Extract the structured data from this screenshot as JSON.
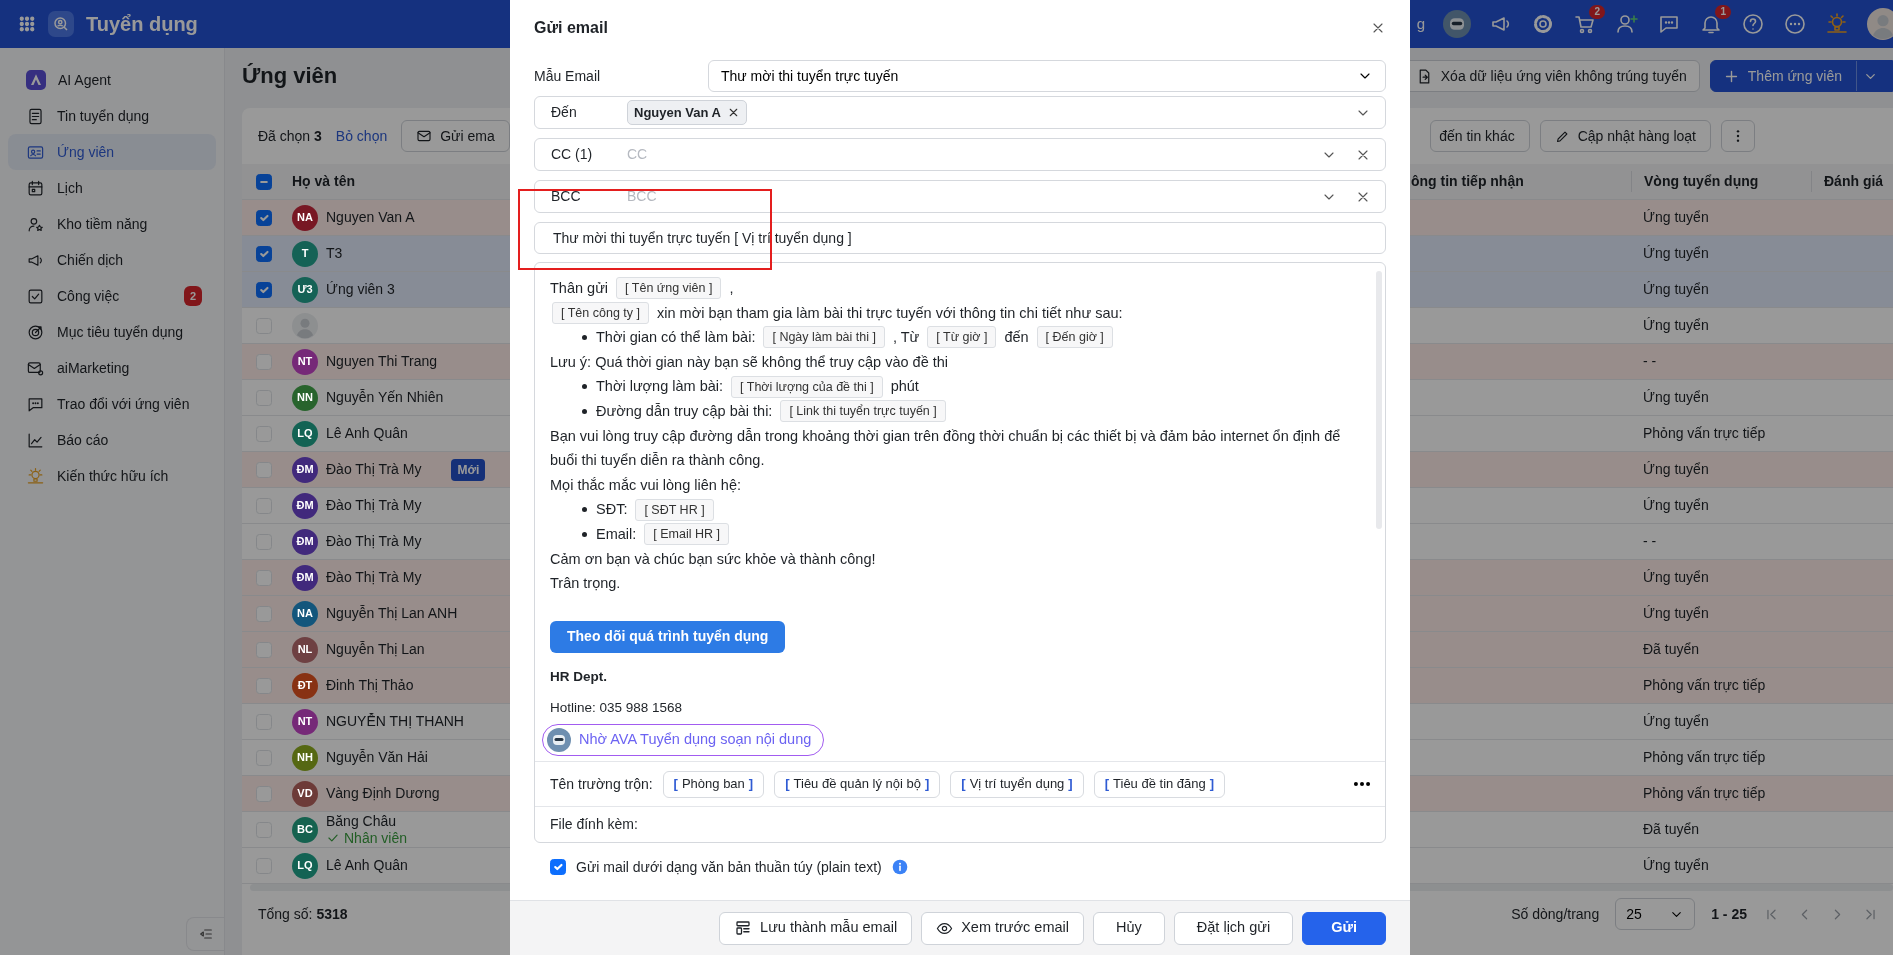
{
  "topbar": {
    "app_title": "Tuyển dụng",
    "clipped_text": "g",
    "actions": [
      {
        "kind": "robot"
      },
      {
        "kind": "megaphone"
      },
      {
        "kind": "gear"
      },
      {
        "kind": "cart",
        "badge": "2"
      },
      {
        "kind": "user-plus"
      },
      {
        "kind": "chat"
      },
      {
        "kind": "bell",
        "badge": "1"
      },
      {
        "kind": "help"
      },
      {
        "kind": "more"
      },
      {
        "kind": "bulb"
      },
      {
        "kind": "avatar"
      }
    ]
  },
  "sidebar": {
    "items": [
      {
        "label": "AI Agent",
        "kind": "agent",
        "selected": false
      },
      {
        "label": "Tin tuyển dụng",
        "kind": "news",
        "selected": false
      },
      {
        "label": "Ứng viên",
        "kind": "idcard",
        "selected": true
      },
      {
        "label": "Lịch",
        "kind": "calendar",
        "selected": false
      },
      {
        "label": "Kho tiềm năng",
        "kind": "talent",
        "selected": false
      },
      {
        "label": "Chiến dịch",
        "kind": "megaphone",
        "selected": false
      },
      {
        "label": "Công việc",
        "kind": "task",
        "selected": false,
        "badge": "2"
      },
      {
        "label": "Mục tiêu tuyển dụng",
        "kind": "target",
        "selected": false
      },
      {
        "label": "aiMarketing",
        "kind": "mailgear",
        "selected": false
      },
      {
        "label": "Trao đổi với ứng viên",
        "kind": "chat",
        "selected": false
      },
      {
        "label": "Báo cáo",
        "kind": "chart",
        "selected": false
      },
      {
        "label": "Kiến thức hữu ích",
        "kind": "bulb",
        "selected": false
      }
    ]
  },
  "page": {
    "title": "Ứng viên",
    "actions": [
      {
        "label": "Xóa dữ liệu ứng viên không trúng tuyển",
        "kind": "outline"
      },
      {
        "label": "Thêm ứng viên",
        "kind": "primary"
      }
    ]
  },
  "table": {
    "selected_label": "Đã chọn",
    "selected_count": "3",
    "clear_selection": "Bỏ chọn",
    "left_actions": [
      {
        "label": "Gửi ema",
        "kind": "mail"
      }
    ],
    "right_actions": [
      {
        "label": "đến tin khác",
        "kind": "plain"
      },
      {
        "label": "Cập nhật hàng loạt",
        "kind": "edit"
      },
      {
        "kind": "kebab"
      }
    ],
    "header_checkbox": {
      "indeterminate": true
    },
    "columns": [
      "Họ và tên",
      "ông tin tiếp nhận",
      "Vòng tuyển dụng",
      "Đánh giá"
    ],
    "rows": [
      {
        "initials": "NA",
        "color": "#781824",
        "name": "Nguyen Van A",
        "checked": true,
        "tinted": true,
        "round": "Ứng tuyển"
      },
      {
        "initials": "T",
        "color": "#156256",
        "name": "T3",
        "checked": true,
        "tinted": false,
        "round": "Ứng tuyển"
      },
      {
        "initials": "Ư3",
        "color": "#156256",
        "name": "Ứng viên 3",
        "checked": true,
        "tinted": false,
        "round": "Ứng tuyển"
      },
      {
        "checked": false,
        "tinted": false,
        "round": "Ứng tuyển"
      },
      {
        "initials": "NT",
        "color": "#762978",
        "name": "Nguyen Thi Trang",
        "checked": false,
        "tinted": true,
        "round": "- -"
      },
      {
        "initials": "NN",
        "color": "#28642d",
        "name": "Nguyễn Yến Nhiên",
        "checked": false,
        "tinted": false,
        "round": "Ứng tuyển"
      },
      {
        "initials": "LQ",
        "color": "#136354",
        "name": "Lê Anh Quân",
        "checked": false,
        "tinted": false,
        "round": "Phỏng vấn trực tiếp"
      },
      {
        "initials": "ĐM",
        "color": "#41297c",
        "name": "Đào Thị Trà My",
        "tag": "Mới",
        "checked": false,
        "tinted": true,
        "round": "Ứng tuyển"
      },
      {
        "initials": "ĐM",
        "color": "#41297c",
        "name": "Đào Thị Trà My",
        "checked": false,
        "tinted": false,
        "round": "Ứng tuyển"
      },
      {
        "initials": "ĐM",
        "color": "#41297c",
        "name": "Đào Thị Trà My",
        "checked": false,
        "tinted": false,
        "round": "- -"
      },
      {
        "initials": "ĐM",
        "color": "#41297c",
        "name": "Đào Thị Trà My",
        "checked": false,
        "tinted": true,
        "round": "Ứng tuyển"
      },
      {
        "initials": "NA",
        "color": "#13567c",
        "name": "Nguyễn Thị Lan ANH",
        "checked": false,
        "tinted": true,
        "round": "Ứng tuyển"
      },
      {
        "initials": "NL",
        "color": "#6e4042",
        "name": "Nguyễn Thị Lan",
        "checked": false,
        "tinted": true,
        "round": "Đã tuyển"
      },
      {
        "initials": "ĐT",
        "color": "#883213",
        "name": "Đinh Thị Thảo",
        "checked": false,
        "tinted": true,
        "round": "Phỏng vấn trực tiếp"
      },
      {
        "initials": "NT",
        "color": "#762978",
        "name": "NGUYỄN THỊ THANH",
        "checked": false,
        "tinted": false,
        "round": "Ứng tuyển"
      },
      {
        "initials": "NH",
        "color": "#566813",
        "name": "Nguyễn Văn Hải",
        "checked": false,
        "tinted": false,
        "round": "Phỏng vấn trực tiếp"
      },
      {
        "initials": "VD",
        "color": "#6d3b38",
        "name": "Vàng Định Dương",
        "checked": false,
        "tinted": true,
        "round": "Phỏng vấn trực tiếp"
      },
      {
        "initials": "BC",
        "color": "#15624f",
        "name": "Băng Châu",
        "note": "Nhân viên",
        "checked": false,
        "tinted": false,
        "round": "Đã tuyển"
      },
      {
        "initials": "LQ",
        "color": "#136354",
        "name": "Lê Anh Quân",
        "checked": false,
        "tinted": false,
        "round": "Ứng tuyển"
      }
    ],
    "total_label": "Tổng số:",
    "total": "5318",
    "page_size_label": "Số dòng/trang",
    "page_size": "25",
    "range": "1 - 25"
  },
  "modal": {
    "title": "Gửi email",
    "template_label": "Mẫu Email",
    "template": "Thư mời thi tuyển trực tuyến",
    "recipients": [
      {
        "label": "Đến",
        "chips": [
          "Nguyen Van A"
        ],
        "clearable": false
      },
      {
        "label": "CC (1)",
        "placeholder": "CC",
        "clearable": true
      },
      {
        "label": "BCC",
        "placeholder": "BCC",
        "clearable": true
      }
    ],
    "highlight": true,
    "subject": "Thư mời thi tuyển trực tuyến [ Vị trí tuyển dụng ]",
    "body": [
      {
        "kind": "line",
        "parts": [
          {
            "kind": "text",
            "text": "Thân gửi"
          },
          {
            "kind": "field",
            "text": "[ Tên ứng viên ]"
          },
          {
            "kind": "text",
            "text": ","
          }
        ]
      },
      {
        "kind": "line",
        "parts": [
          {
            "kind": "field",
            "text": "[ Tên công ty ]"
          },
          {
            "kind": "text",
            "text": "xin mời bạn tham gia làm bài thi trực tuyến với thông tin chi tiết như sau:"
          }
        ]
      },
      {
        "kind": "bullet",
        "parts": [
          {
            "kind": "text",
            "text": "Thời gian có thể làm bài:"
          },
          {
            "kind": "field",
            "text": "[ Ngày làm bài thi ]"
          },
          {
            "kind": "text",
            "text": ", Từ"
          },
          {
            "kind": "field",
            "text": "[ Từ giờ ]"
          },
          {
            "kind": "text",
            "text": "đến"
          },
          {
            "kind": "field",
            "text": "[ Đến giờ ]"
          }
        ]
      },
      {
        "kind": "line",
        "parts": [
          {
            "kind": "text",
            "text": "Lưu ý: Quá thời gian này bạn sẽ không thể truy cập vào đề thi"
          }
        ]
      },
      {
        "kind": "bullet",
        "parts": [
          {
            "kind": "text",
            "text": "Thời lượng làm bài:"
          },
          {
            "kind": "field",
            "text": "[ Thời lượng của đề thi ]"
          },
          {
            "kind": "text",
            "text": "phút"
          }
        ]
      },
      {
        "kind": "bullet",
        "parts": [
          {
            "kind": "text",
            "text": "Đường dẫn truy cập bài thi:"
          },
          {
            "kind": "field",
            "text": "[ Link thi tuyển trực tuyến ]"
          }
        ]
      },
      {
        "kind": "line",
        "parts": [
          {
            "kind": "text",
            "text": "Bạn vui lòng truy cập đường dẫn trong khoảng thời gian trên đồng thời chuẩn bị các thiết bị và đảm bảo internet ổn định để buổi thi tuyển diễn ra thành công."
          }
        ]
      },
      {
        "kind": "line",
        "parts": [
          {
            "kind": "text",
            "text": "Mọi thắc mắc vui lòng liên hệ:"
          }
        ]
      },
      {
        "kind": "bullet",
        "parts": [
          {
            "kind": "text",
            "text": "SĐT:"
          },
          {
            "kind": "field",
            "text": "[ SĐT HR ]"
          }
        ]
      },
      {
        "kind": "bullet",
        "parts": [
          {
            "kind": "text",
            "text": "Email:"
          },
          {
            "kind": "field",
            "text": "[ Email HR ]"
          }
        ]
      },
      {
        "kind": "line",
        "parts": [
          {
            "kind": "text",
            "text": "Cảm ơn bạn và chúc bạn sức khỏe và thành công!"
          }
        ]
      },
      {
        "kind": "line",
        "parts": [
          {
            "kind": "text",
            "text": "Trân trọng."
          }
        ]
      }
    ],
    "cta": "Theo dõi quá trình tuyển dụng",
    "signature": "HR Dept.",
    "hotline": "Hotline: 035 988 1568",
    "ai_prompt": "Nhờ AVA Tuyển dụng soạn nội dung",
    "merge_label": "Tên trường trộn:",
    "merge_fields": [
      "[ Phòng ban ]",
      "[ Tiêu đề quản lý nội bộ ]",
      "[ Vị trí tuyển dụng ]",
      "[ Tiêu đề tin đăng ]"
    ],
    "attachments_label": "File đính kèm:",
    "plain_text": {
      "label": "Gửi mail dưới dạng văn bản thuần túy (plain text)",
      "checked": true
    },
    "buttons": [
      {
        "label": "Lưu thành mẫu email",
        "kind": "save"
      },
      {
        "label": "Xem trước email",
        "kind": "preview"
      },
      {
        "label": "Hủy",
        "kind": "plain"
      },
      {
        "label": "Đặt lịch gửi",
        "kind": "plain"
      },
      {
        "label": "Gửi",
        "kind": "send"
      }
    ]
  }
}
